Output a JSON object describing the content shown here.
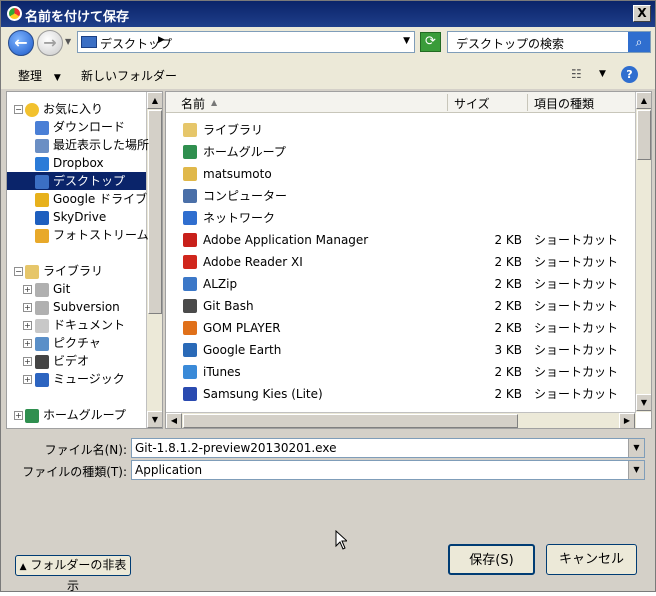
{
  "window": {
    "title": "名前を付けて保存",
    "close_label": "X"
  },
  "nav": {
    "address": "デスクトップ",
    "search_placeholder": "デスクトップの検索"
  },
  "toolbar": {
    "organize": "整理",
    "new_folder": "新しいフォルダー"
  },
  "tree": [
    {
      "label": "お気に入り",
      "icon": "star-icon",
      "color": "#f2c12e",
      "level": 0,
      "expander": "−"
    },
    {
      "label": "ダウンロード",
      "icon": "download-folder-icon",
      "color": "#4a7fd6",
      "level": 1
    },
    {
      "label": "最近表示した場所",
      "icon": "recent-places-icon",
      "color": "#6b8fc4",
      "level": 1
    },
    {
      "label": "Dropbox",
      "icon": "dropbox-icon",
      "color": "#2b7bd8",
      "level": 1
    },
    {
      "label": "デスクトップ",
      "icon": "desktop-icon",
      "color": "#3b6fc4",
      "level": 1,
      "selected": true
    },
    {
      "label": "Google ドライブ",
      "icon": "google-drive-icon",
      "color": "#e7b11c",
      "level": 1
    },
    {
      "label": "SkyDrive",
      "icon": "skydrive-icon",
      "color": "#1e5fbf",
      "level": 1
    },
    {
      "label": "フォトストリーム",
      "icon": "photostream-icon",
      "color": "#e8a92a",
      "level": 1
    },
    {
      "label": "ライブラリ",
      "icon": "library-icon",
      "color": "#e6c66a",
      "level": 0,
      "expander": "−",
      "gap": true
    },
    {
      "label": "Git",
      "icon": "git-folder-icon",
      "color": "#b0b0b0",
      "level": 1,
      "expander": "+"
    },
    {
      "label": "Subversion",
      "icon": "svn-folder-icon",
      "color": "#b0b0b0",
      "level": 1,
      "expander": "+"
    },
    {
      "label": "ドキュメント",
      "icon": "documents-icon",
      "color": "#c8c8c8",
      "level": 1,
      "expander": "+"
    },
    {
      "label": "ピクチャ",
      "icon": "pictures-icon",
      "color": "#5a8fc8",
      "level": 1,
      "expander": "+"
    },
    {
      "label": "ビデオ",
      "icon": "videos-icon",
      "color": "#444444",
      "level": 1,
      "expander": "+"
    },
    {
      "label": "ミュージック",
      "icon": "music-icon",
      "color": "#2c64c0",
      "level": 1,
      "expander": "+"
    },
    {
      "label": "ホームグループ",
      "icon": "homegroup-icon",
      "color": "#2f8f4f",
      "level": 0,
      "expander": "+",
      "gap": true
    }
  ],
  "list": {
    "columns": {
      "name": "名前",
      "size": "サイズ",
      "type": "項目の種類"
    },
    "rows": [
      {
        "name": "ライブラリ",
        "size": "",
        "type": "",
        "icon": "library-icon",
        "color": "#e6c66a"
      },
      {
        "name": "ホームグループ",
        "size": "",
        "type": "",
        "icon": "homegroup-icon",
        "color": "#2f8f4f"
      },
      {
        "name": "matsumoto",
        "size": "",
        "type": "",
        "icon": "user-folder-icon",
        "color": "#e0b84a"
      },
      {
        "name": "コンピューター",
        "size": "",
        "type": "",
        "icon": "computer-icon",
        "color": "#4a6fa8"
      },
      {
        "name": "ネットワーク",
        "size": "",
        "type": "",
        "icon": "network-icon",
        "color": "#2f6ecf"
      },
      {
        "name": "Adobe Application Manager",
        "size": "2 KB",
        "type": "ショートカット",
        "icon": "adobe-icon",
        "color": "#c8201a"
      },
      {
        "name": "Adobe Reader XI",
        "size": "2 KB",
        "type": "ショートカット",
        "icon": "adobe-reader-icon",
        "color": "#d0261c"
      },
      {
        "name": "ALZip",
        "size": "2 KB",
        "type": "ショートカット",
        "icon": "alzip-icon",
        "color": "#3c78c8"
      },
      {
        "name": "Git Bash",
        "size": "2 KB",
        "type": "ショートカット",
        "icon": "git-bash-icon",
        "color": "#4a4a4a"
      },
      {
        "name": "GOM PLAYER",
        "size": "2 KB",
        "type": "ショートカット",
        "icon": "gom-player-icon",
        "color": "#e0701a"
      },
      {
        "name": "Google Earth",
        "size": "3 KB",
        "type": "ショートカット",
        "icon": "google-earth-icon",
        "color": "#2a6ab8"
      },
      {
        "name": "iTunes",
        "size": "2 KB",
        "type": "ショートカット",
        "icon": "itunes-icon",
        "color": "#3a8ad8"
      },
      {
        "name": "Samsung Kies (Lite)",
        "size": "2 KB",
        "type": "ショートカット",
        "icon": "samsung-kies-icon",
        "color": "#2a4ab0"
      }
    ]
  },
  "form": {
    "filename_label": "ファイル名(N):",
    "filename_value": "Git-1.8.1.2-preview20130201.exe",
    "filetype_label": "ファイルの種類(T):",
    "filetype_value": "Application"
  },
  "buttons": {
    "hide_folders": "フォルダーの非表示",
    "save": "保存(S)",
    "cancel": "キャンセル"
  }
}
